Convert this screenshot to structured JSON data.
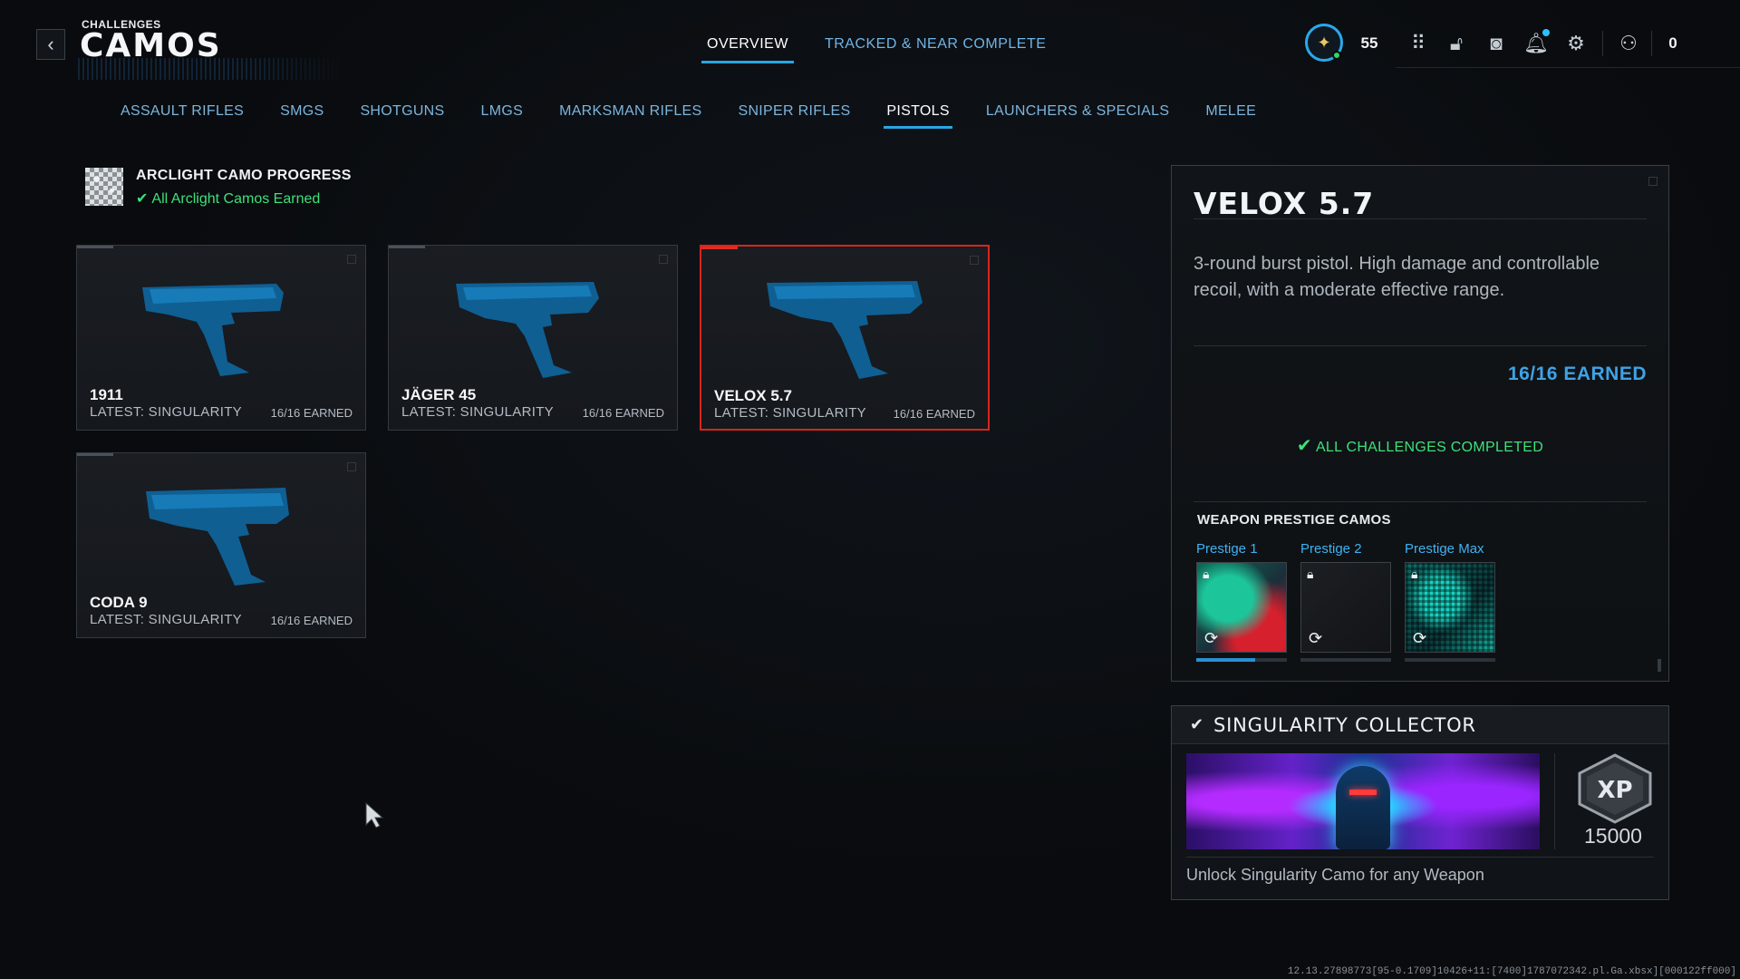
{
  "header": {
    "back_icon": "chevron-left-icon",
    "breadcrumb": "CHALLENGES",
    "title": "CAMOS",
    "tabs": [
      {
        "label": "OVERVIEW",
        "active": true
      },
      {
        "label": "TRACKED & NEAR COMPLETE",
        "active": false
      }
    ],
    "hud": {
      "level": "55",
      "icons": [
        "prestige-emblem-icon",
        "grid-menu-icon",
        "store-lock-icon",
        "camera-icon",
        "notification-bell-icon",
        "settings-gear-icon",
        "party-icon"
      ],
      "party_count": "0"
    }
  },
  "categories": [
    {
      "label": "ASSAULT RIFLES",
      "active": false
    },
    {
      "label": "SMGS",
      "active": false
    },
    {
      "label": "SHOTGUNS",
      "active": false
    },
    {
      "label": "LMGS",
      "active": false
    },
    {
      "label": "MARKSMAN RIFLES",
      "active": false
    },
    {
      "label": "SNIPER RIFLES",
      "active": false
    },
    {
      "label": "PISTOLS",
      "active": true
    },
    {
      "label": "LAUNCHERS & SPECIALS",
      "active": false
    },
    {
      "label": "MELEE",
      "active": false
    }
  ],
  "arclight": {
    "title": "ARCLIGHT CAMO PROGRESS",
    "status": "All Arclight Camos Earned"
  },
  "weapons": [
    {
      "name": "1911",
      "latest": "LATEST: SINGULARITY",
      "earned": "16/16 EARNED",
      "selected": false
    },
    {
      "name": "JÄGER 45",
      "latest": "LATEST: SINGULARITY",
      "earned": "16/16 EARNED",
      "selected": false
    },
    {
      "name": "VELOX 5.7",
      "latest": "LATEST: SINGULARITY",
      "earned": "16/16 EARNED",
      "selected": true
    },
    {
      "name": "CODA 9",
      "latest": "LATEST: SINGULARITY",
      "earned": "16/16 EARNED",
      "selected": false
    }
  ],
  "detail": {
    "title": "VELOX 5.7",
    "description": "3-round burst pistol. High damage and controllable recoil, with a moderate effective range.",
    "earned": "16/16 EARNED",
    "all_complete": "ALL CHALLENGES COMPLETED",
    "prestige_heading": "WEAPON PRESTIGE CAMOS",
    "prestige": [
      {
        "label": "Prestige 1",
        "progress": 0.65
      },
      {
        "label": "Prestige 2",
        "progress": 0
      },
      {
        "label": "Prestige Max",
        "progress": 0
      }
    ]
  },
  "reward": {
    "title": "SINGULARITY COLLECTOR",
    "xp_label": "XP",
    "xp": "15000",
    "description": "Unlock Singularity Camo for any Weapon"
  },
  "build_string": "12.13.27898773[95-0.1709]10426+11:[7400]1787072342.pl.Ga.xbsx][000122ff000]",
  "colors": {
    "accent_blue": "#27a6e3",
    "success_green": "#3ee07a",
    "selected_red": "#d8251d",
    "earned_blue": "#3fa2e6"
  }
}
